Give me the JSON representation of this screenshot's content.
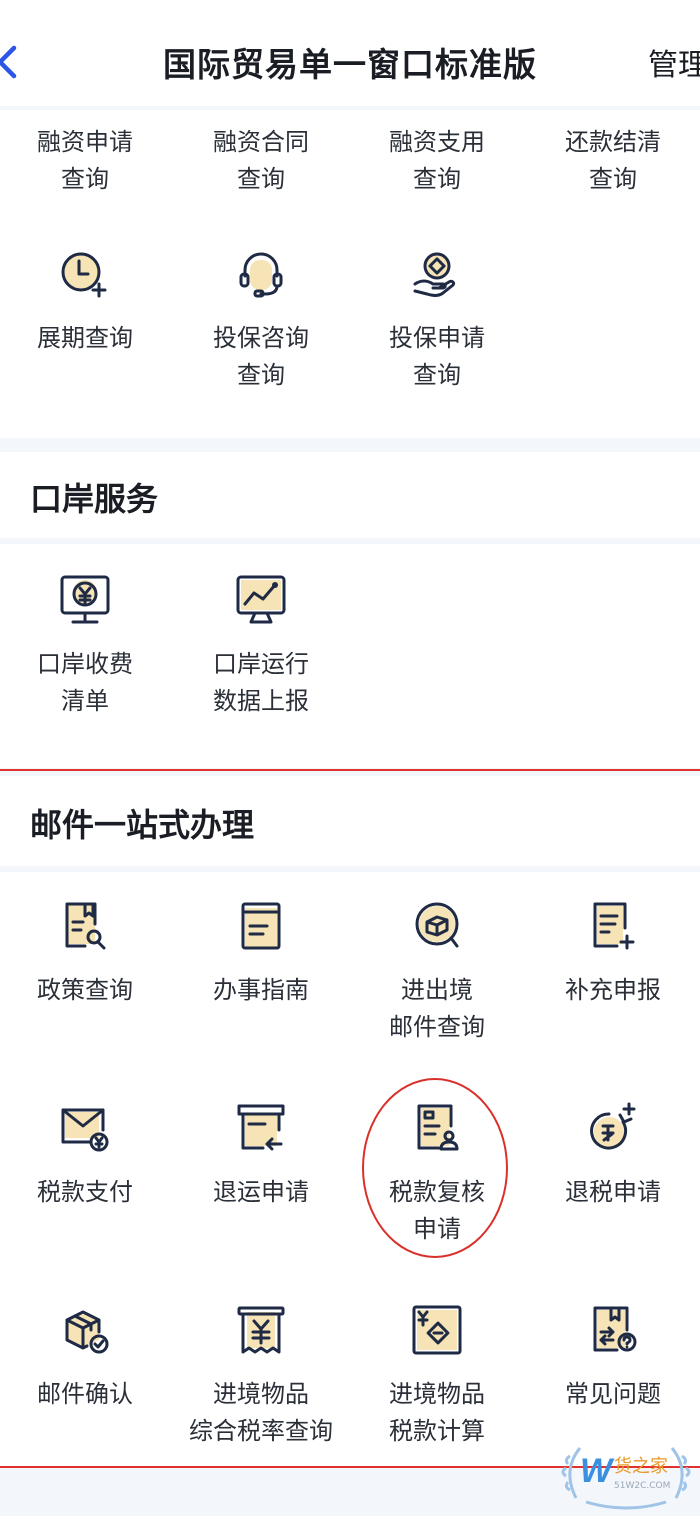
{
  "header": {
    "title": "国际贸易单一窗口标准版",
    "manage_label": "管理"
  },
  "finance": {
    "row1": [
      {
        "l1": "融资申请",
        "l2": "查询"
      },
      {
        "l1": "融资合同",
        "l2": "查询"
      },
      {
        "l1": "融资支用",
        "l2": "查询"
      },
      {
        "l1": "还款结清",
        "l2": "查询"
      }
    ],
    "row2": [
      {
        "l1": "展期查询",
        "l2": "",
        "icon": "clock-plus-icon"
      },
      {
        "l1": "投保咨询",
        "l2": "查询",
        "icon": "headset-icon"
      },
      {
        "l1": "投保申请",
        "l2": "查询",
        "icon": "hand-coin-icon"
      }
    ]
  },
  "port": {
    "title": "口岸服务",
    "items": [
      {
        "l1": "口岸收费",
        "l2": "清单",
        "icon": "monitor-yen-icon"
      },
      {
        "l1": "口岸运行",
        "l2": "数据上报",
        "icon": "monitor-chart-icon"
      }
    ]
  },
  "mail": {
    "title": "邮件一站式办理",
    "items": [
      {
        "l1": "政策查询",
        "l2": "",
        "icon": "document-search-icon"
      },
      {
        "l1": "办事指南",
        "l2": "",
        "icon": "guide-book-icon"
      },
      {
        "l1": "进出境",
        "l2": "邮件查询",
        "icon": "parcel-search-icon"
      },
      {
        "l1": "补充申报",
        "l2": "",
        "icon": "document-plus-icon"
      },
      {
        "l1": "税款支付",
        "l2": "",
        "icon": "envelope-yen-icon"
      },
      {
        "l1": "退运申请",
        "l2": "",
        "icon": "return-box-icon"
      },
      {
        "l1": "税款复核",
        "l2": "申请",
        "icon": "document-person-icon"
      },
      {
        "l1": "退税申请",
        "l2": "",
        "icon": "tax-refund-icon"
      },
      {
        "l1": "邮件确认",
        "l2": "",
        "icon": "package-check-icon"
      },
      {
        "l1": "进境物品",
        "l2": "综合税率查询",
        "icon": "receipt-yen-icon"
      },
      {
        "l1": "进境物品",
        "l2": "税款计算",
        "icon": "tax-calc-icon"
      },
      {
        "l1": "常见问题",
        "l2": "",
        "icon": "faq-book-icon"
      }
    ]
  },
  "watermark": {
    "text": "货之家",
    "sub": "51W2C.COM"
  }
}
